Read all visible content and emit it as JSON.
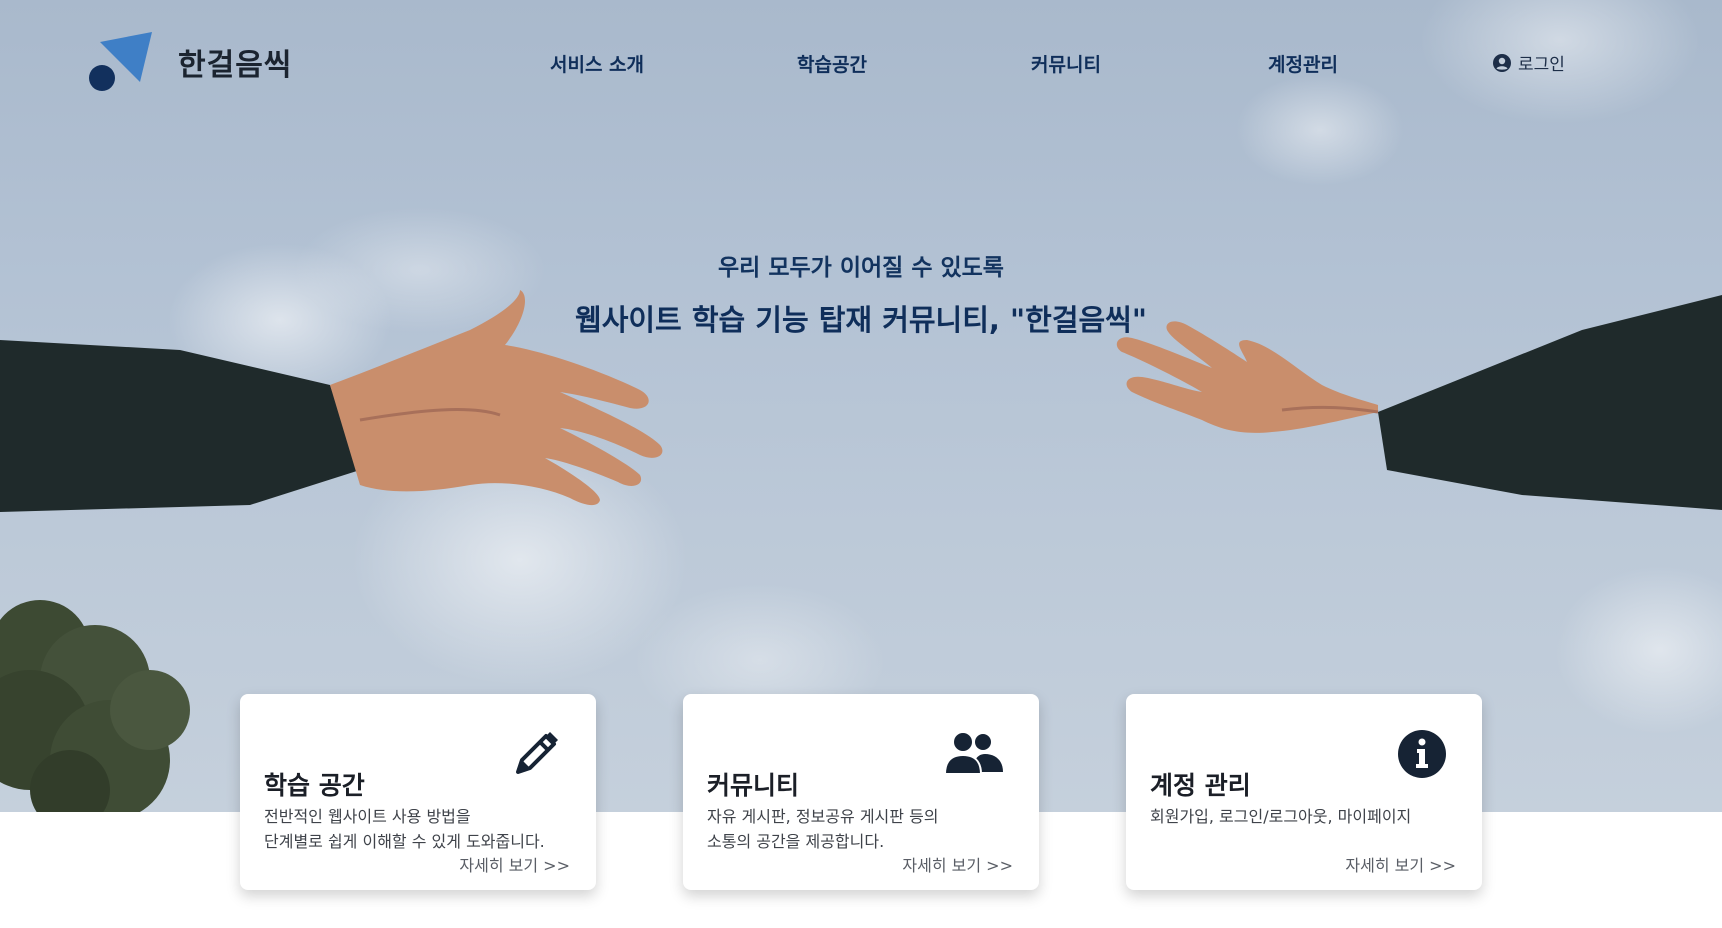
{
  "brand": {
    "name": "한걸음씩",
    "logo_icon": "logo-icon"
  },
  "nav": {
    "items": [
      {
        "label": "서비스 소개"
      },
      {
        "label": "학습공간"
      },
      {
        "label": "커뮤니티"
      },
      {
        "label": "계정관리"
      }
    ],
    "login": {
      "label": "로그인",
      "icon": "user-circle-icon"
    }
  },
  "hero": {
    "subtitle": "우리 모두가 이어질 수 있도록",
    "title": "웹사이트 학습 기능 탑재 커뮤니티, \"한걸음씩\""
  },
  "cards": [
    {
      "title": "학습 공간",
      "desc_lines": [
        "전반적인 웹사이트 사용 방법을",
        "단계별로 쉽게 이해할 수 있게 도와줍니다."
      ],
      "more": "자세히 보기 >>",
      "icon": "pencil-icon"
    },
    {
      "title": "커뮤니티",
      "desc_lines": [
        "자유 게시판, 정보공유 게시판 등의",
        "소통의 공간을 제공합니다."
      ],
      "more": "자세히 보기 >>",
      "icon": "users-icon"
    },
    {
      "title": "계정 관리",
      "desc_lines": [
        "회원가입, 로그인/로그아웃, 마이페이지"
      ],
      "more": "자세히 보기 >>",
      "icon": "info-icon"
    }
  ],
  "colors": {
    "nav_text": "#0f2e5a",
    "logo_blue": "#3f7fc6",
    "logo_navy": "#12305d",
    "icon_dark": "#162334"
  }
}
